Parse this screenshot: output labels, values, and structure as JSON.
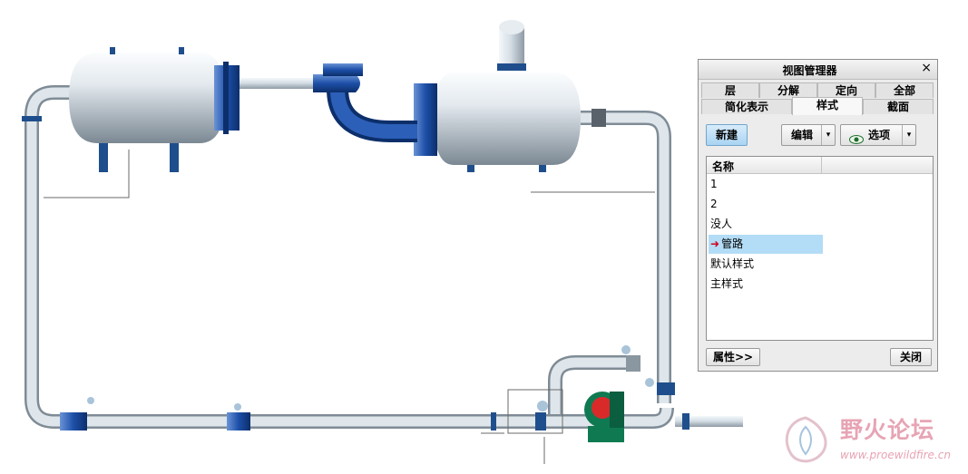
{
  "dialog": {
    "title": "视图管理器",
    "close_glyph": "×",
    "tabs_row1": [
      "层",
      "分解",
      "定向",
      "全部"
    ],
    "tabs_row2": [
      "简化表示",
      "样式",
      "截面"
    ],
    "active_tab": "样式",
    "toolbar": {
      "new_label": "新建",
      "edit_label": "编辑",
      "options_label": "选项",
      "caret": "▾",
      "eye_icon": "eye-icon"
    },
    "list": {
      "column_header": "名称",
      "items": [
        "1",
        "2",
        "没人",
        "管路",
        "默认样式",
        "主样式"
      ],
      "selected_item": "管路",
      "active_marker": "➜"
    },
    "footer": {
      "properties_label": "属性>>",
      "close_label": "关闭"
    }
  },
  "watermark": {
    "name": "野火论坛",
    "url": "www.proewildfire.cn"
  },
  "colors": {
    "pipe": "#cbd6de",
    "flange": "#1f4e8c",
    "pump_green": "#0f7a52",
    "pump_red": "#d92a2a",
    "dialog_bg": "#ececec",
    "selection": "#b3dcf6",
    "accent_blue": "#a9d4f2"
  }
}
